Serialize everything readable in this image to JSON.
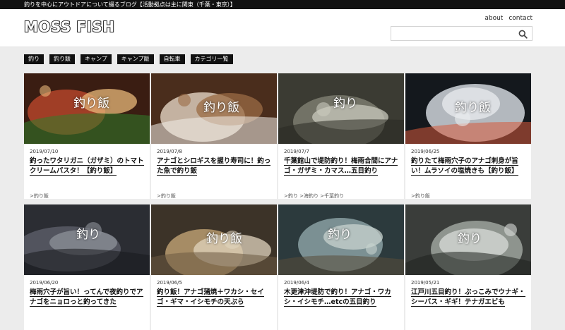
{
  "topbar": {
    "text": "釣りを中心にアウトドアについて綴るブログ【活動拠点は主に関東（千葉・東京）】"
  },
  "header": {
    "logo": "MOSS FISH",
    "links": [
      "about",
      "contact"
    ],
    "search_placeholder": ""
  },
  "categories": [
    "釣り",
    "釣り飯",
    "キャンプ",
    "キャンプ飯",
    "自転車",
    "カテゴリ一覧"
  ],
  "posts": [
    {
      "date": "2019/07/10",
      "title": "釣ったワタリガニ（ガザミ）のトマトクリームパスタ！【釣り飯】",
      "tags": ">釣り飯",
      "overlay": "釣り飯",
      "palette": [
        "#3a1d12",
        "#b3442a",
        "#e8b87a",
        "#2f7d2a"
      ]
    },
    {
      "date": "2019/07/8",
      "title": "アナゴとシロギスを握り寿司に！釣った魚で釣り飯",
      "tags": ">釣り飯",
      "overlay": "釣り飯",
      "palette": [
        "#4a2d1c",
        "#d9cab8",
        "#9b6b44",
        "#f2efe9"
      ]
    },
    {
      "date": "2019/07/7",
      "title": "千葉館山で堤防釣り！梅雨合間にアナゴ・ガザミ・カマス…五目釣り",
      "tags": ">釣り >海釣り >千葉釣り",
      "overlay": "釣り",
      "palette": [
        "#3b3b33",
        "#7c7c70",
        "#c9c9bd",
        "#2a2a22"
      ]
    },
    {
      "date": "2019/06/25",
      "title": "釣りたて梅雨穴子のアナゴ刺身が旨い！ムラソイの塩焼きも【釣り飯】",
      "tags": ">釣り飯",
      "overlay": "釣り飯",
      "palette": [
        "#14181d",
        "#cfd5db",
        "#e9ecef",
        "#d65a3a"
      ]
    },
    {
      "date": "2019/06/20",
      "title": "梅雨穴子が旨い！ってんで夜釣りでアナゴをニョロっと釣ってきた",
      "tags": "",
      "overlay": "釣り",
      "palette": [
        "#2b2d33",
        "#595c66",
        "#8e919a",
        "#18191d"
      ]
    },
    {
      "date": "2019/06/5",
      "title": "釣り飯！アナゴ蒲焼＋ワカシ・セイゴ・ギマ・イシモチの天ぷら",
      "tags": "",
      "overlay": "釣り飯",
      "palette": [
        "#3c3328",
        "#b89c70",
        "#e0d4bd",
        "#6b5a42"
      ]
    },
    {
      "date": "2019/06/4",
      "title": "木更津沖堤防で釣り！アナゴ・ワカシ・イシモチ…etcの五目釣り",
      "tags": "",
      "overlay": "釣り",
      "palette": [
        "#2c3a3d",
        "#8aa0a2",
        "#c8d3cf",
        "#5a4c3a"
      ]
    },
    {
      "date": "2019/05/21",
      "title": "江戸川五目釣り！ぶっこみでウナギ・シーバス・ギギ！テナガエビも",
      "tags": "",
      "overlay": "釣り",
      "palette": [
        "#3a3d3a",
        "#9ea39e",
        "#d8dcd8",
        "#1f221f"
      ]
    }
  ]
}
